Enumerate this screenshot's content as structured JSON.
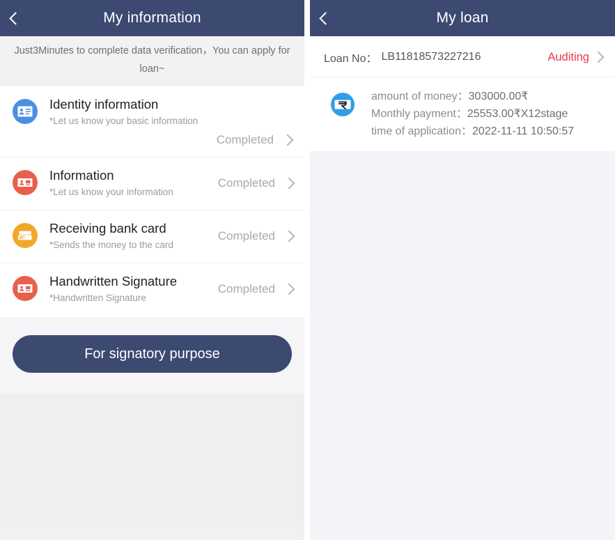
{
  "theme": {
    "appbar_bg": "#3c4a72",
    "accent_red": "#e23b50",
    "muted_gray": "#a9a9a9"
  },
  "left_panel": {
    "header": {
      "title": "My information",
      "back_icon": "chevron-left-icon"
    },
    "notice": "Just3Minutes to complete data verification，You can apply for loan~",
    "items": [
      {
        "title": "Identity information",
        "subtitle": "*Let us know your basic information",
        "status": "Completed",
        "icon": "id-card-icon",
        "icon_color": "#4a90e2",
        "status_below": true
      },
      {
        "title": "Information",
        "subtitle": "*Let us know your information",
        "status": "Completed",
        "icon": "contact-card-icon",
        "icon_color": "#e8604c",
        "status_below": false
      },
      {
        "title": "Receiving bank card",
        "subtitle": "*Sends the money to the card",
        "status": "Completed",
        "icon": "bank-card-icon",
        "icon_color": "#f0a829",
        "status_below": false
      },
      {
        "title": "Handwritten Signature",
        "subtitle": "*Handwritten Signature",
        "status": "Completed",
        "icon": "signature-card-icon",
        "icon_color": "#e8604c",
        "status_below": false
      }
    ],
    "cta_label": "For signatory purpose"
  },
  "right_panel": {
    "header": {
      "title": "My loan",
      "back_icon": "chevron-left-icon"
    },
    "loan_no_label": "Loan No：",
    "loan_no_value": "LB11818573227216",
    "status": "Auditing",
    "details": {
      "icon": "rupee-note-icon",
      "amount_label": "amount of money：",
      "amount_value": "303000.00₹",
      "monthly_label": "Monthly payment：",
      "monthly_value": "25553.00₹X12stage",
      "time_label": "time of application：",
      "time_value": "2022-11-11 10:50:57"
    }
  }
}
